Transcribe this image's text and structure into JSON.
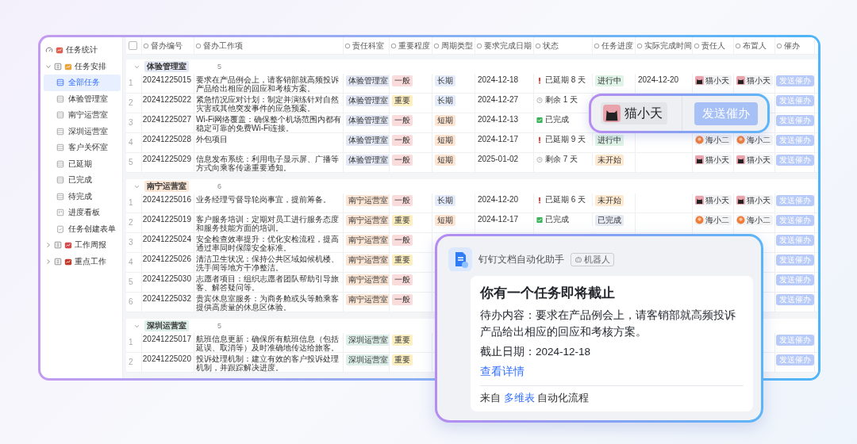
{
  "sidebar": {
    "items": [
      {
        "kind": "dashboard",
        "label": "任务统计",
        "selected": false
      },
      {
        "kind": "folder",
        "label": "任务安排",
        "selected": false,
        "expanded": true,
        "children": [
          {
            "kind": "table",
            "label": "全部任务",
            "selected": true
          },
          {
            "kind": "table",
            "label": "体验管理室",
            "selected": false
          },
          {
            "kind": "table",
            "label": "南宁运营室",
            "selected": false
          },
          {
            "kind": "table",
            "label": "深圳运营室",
            "selected": false
          },
          {
            "kind": "table",
            "label": "客户关怀室",
            "selected": false
          },
          {
            "kind": "table",
            "label": "已延期",
            "selected": false
          },
          {
            "kind": "table",
            "label": "已完成",
            "selected": false
          },
          {
            "kind": "table",
            "label": "待完成",
            "selected": false
          },
          {
            "kind": "kanban",
            "label": "进度看板",
            "selected": false
          },
          {
            "kind": "form",
            "label": "任务创建表单",
            "selected": false
          }
        ]
      },
      {
        "kind": "folder",
        "label": "工作周报",
        "selected": false,
        "expanded": false
      },
      {
        "kind": "folder",
        "label": "重点工作",
        "selected": false,
        "expanded": false
      }
    ]
  },
  "table": {
    "select_all_checked": false,
    "columns": [
      "督办编号",
      "督办工作项",
      "责任科室",
      "重要程度",
      "周期类型",
      "要求完成日期",
      "状态",
      "任务进度",
      "实际完成时间",
      "责任人",
      "布置人",
      "催办"
    ],
    "groups": [
      {
        "name": "体验管理室",
        "count": "5",
        "color": "#e3e8f4",
        "rows": [
          {
            "no": "1",
            "id": "20241225015",
            "item": "要求在产品例会上，请客销部就高频投诉产品给出相应的回应和考核方案。",
            "dept": {
              "text": "体验管理室",
              "color": "#e3e8f4"
            },
            "priority": {
              "text": "一般",
              "color": "#fbdcdc"
            },
            "cycle": {
              "text": "长期",
              "color": "#e4ecfb"
            },
            "due": "2024-12-18",
            "status": {
              "kind": "overdue",
              "text": "已延期 8 天"
            },
            "progress": {
              "text": "进行中",
              "color": "#dff3e6"
            },
            "actual": "2024-12-20",
            "owner": {
              "kind": "cat",
              "name": "猫小天"
            },
            "assigner": {
              "kind": "cat",
              "name": "猫小天"
            },
            "action": "发送催办"
          },
          {
            "no": "2",
            "id": "20241225022",
            "item": "紧急情况应对计划：制定并演练针对自然灾害或其他突发事件的应急预案。",
            "dept": {
              "text": "体验管理室",
              "color": "#e3e8f4"
            },
            "priority": {
              "text": "重要",
              "color": "#fcefc2"
            },
            "cycle": {
              "text": "长期",
              "color": "#e4ecfb"
            },
            "due": "2024-12-27",
            "status": {
              "kind": "remaining",
              "text": "剩余 1 天"
            },
            "action": "发送催办"
          },
          {
            "no": "3",
            "id": "20241225027",
            "item": "Wi-Fi网络覆盖：确保整个机场范围内都有稳定可靠的免费Wi-Fi连接。",
            "dept": {
              "text": "体验管理室",
              "color": "#e3e8f4"
            },
            "priority": {
              "text": "一般",
              "color": "#fbdcdc"
            },
            "cycle": {
              "text": "短期",
              "color": "#fde5d2"
            },
            "due": "2024-12-13",
            "status": {
              "kind": "done",
              "text": "已完成"
            },
            "action": "发送催办"
          },
          {
            "no": "4",
            "id": "20241225028",
            "item": "外包项目",
            "dept": {
              "text": "体验管理室",
              "color": "#e3e8f4"
            },
            "priority": {
              "text": "一般",
              "color": "#fbdcdc"
            },
            "cycle": {
              "text": "短期",
              "color": "#fde5d2"
            },
            "due": "2024-12-17",
            "status": {
              "kind": "overdue",
              "text": "已延期 9 天"
            },
            "progress": {
              "text": "进行中",
              "color": "#dff3e6"
            },
            "owner": {
              "kind": "round",
              "name": "海小二"
            },
            "assigner": {
              "kind": "round",
              "name": "海小二"
            },
            "action": "发送催办"
          },
          {
            "no": "5",
            "id": "20241225029",
            "item": "信息发布系统：利用电子显示屏、广播等方式向乘客传递重要通知。",
            "dept": {
              "text": "体验管理室",
              "color": "#e3e8f4"
            },
            "priority": {
              "text": "一般",
              "color": "#fbdcdc"
            },
            "cycle": {
              "text": "短期",
              "color": "#fde5d2"
            },
            "due": "2025-01-02",
            "status": {
              "kind": "remaining",
              "text": "剩余 7 天"
            },
            "progress": {
              "text": "未开始",
              "color": "#fde9cf"
            },
            "owner": {
              "kind": "cat",
              "name": "猫小天"
            },
            "assigner": {
              "kind": "cat",
              "name": "猫小天"
            },
            "action": "发送催办"
          }
        ]
      },
      {
        "name": "南宁运营室",
        "count": "6",
        "color": "#fbe6d6",
        "rows": [
          {
            "no": "1",
            "id": "20241225016",
            "item": "业务经理亏督导轮岗事宜，提前筹备。",
            "dept": {
              "text": "南宁运营室",
              "color": "#fbe6d6"
            },
            "priority": {
              "text": "一般",
              "color": "#fbdcdc"
            },
            "cycle": {
              "text": "长期",
              "color": "#e4ecfb"
            },
            "due": "2024-12-20",
            "status": {
              "kind": "overdue",
              "text": "已延期 6 天"
            },
            "progress": {
              "text": "未开始",
              "color": "#fde9cf"
            },
            "owner": {
              "kind": "cat",
              "name": "猫小天"
            },
            "assigner": {
              "kind": "cat",
              "name": "猫小天"
            },
            "action": "发送催办"
          },
          {
            "no": "2",
            "id": "20241225019",
            "item": "客户服务培训：定期对员工进行服务态度和服务技能方面的培训。",
            "dept": {
              "text": "南宁运营室",
              "color": "#fbe6d6"
            },
            "priority": {
              "text": "重要",
              "color": "#fcefc2"
            },
            "cycle": {
              "text": "短期",
              "color": "#fde5d2"
            },
            "due": "2024-12-17",
            "status": {
              "kind": "done",
              "text": "已完成"
            },
            "progress": {
              "text": "已完成",
              "color": "#e6eaf3"
            },
            "owner": {
              "kind": "round",
              "name": "海小二"
            },
            "assigner": {
              "kind": "round",
              "name": "海小二"
            },
            "action": "发送催办"
          },
          {
            "no": "3",
            "id": "20241225024",
            "item": "安全检查效率提升：优化安检流程，提高通过率同时保障安全标准。",
            "dept": {
              "text": "南宁运营室",
              "color": "#fbe6d6"
            },
            "priority": {
              "text": "一般",
              "color": "#fbdcdc"
            },
            "action": "发送催办"
          },
          {
            "no": "4",
            "id": "20241225026",
            "item": "清洁卫生状况：保持公共区域如候机楼、洗手间等地方干净整洁。",
            "dept": {
              "text": "南宁运营室",
              "color": "#fbe6d6"
            },
            "priority": {
              "text": "重要",
              "color": "#fcefc2"
            },
            "action": "发送催办"
          },
          {
            "no": "5",
            "id": "20241225030",
            "item": "志愿者项目：组织志愿者团队帮助引导旅客、解答疑问等。",
            "dept": {
              "text": "南宁运营室",
              "color": "#fbe6d6"
            },
            "priority": {
              "text": "一般",
              "color": "#fbdcdc"
            },
            "action": "发送催办"
          },
          {
            "no": "6",
            "id": "20241225032",
            "item": "贵宾休息室服务：为商务舱或头等舱乘客提供高质量的休息区体验。",
            "dept": {
              "text": "南宁运营室",
              "color": "#fbe6d6"
            },
            "priority": {
              "text": "一般",
              "color": "#fbdcdc"
            },
            "action": "发送催办"
          }
        ]
      },
      {
        "name": "深圳运营室",
        "count": "5",
        "color": "#dff0ea",
        "rows": [
          {
            "no": "1",
            "id": "20241225017",
            "item": "航班信息更新：确保所有航班信息（包括延误、取消等）及时准确地传达给旅客。",
            "dept": {
              "text": "深圳运营室",
              "color": "#dff0ea"
            },
            "priority": {
              "text": "重要",
              "color": "#fcefc2"
            },
            "action": "发送催办"
          },
          {
            "no": "2",
            "id": "20241225020",
            "item": "投诉处理机制：建立有效的客户投诉处理机制，并跟踪解决进度。",
            "dept": {
              "text": "深圳运营室",
              "color": "#dff0ea"
            },
            "priority": {
              "text": "重要",
              "color": "#fcefc2"
            },
            "action": "发送催办"
          }
        ]
      }
    ]
  },
  "callout": {
    "person": {
      "kind": "cat",
      "name": "猫小天"
    },
    "button": "发送催办"
  },
  "notification": {
    "sender": "钉钉文档自动化助手",
    "tag": "机器人",
    "title": "你有一个任务即将截止",
    "body": "待办内容：要求在产品例会上，请客销部就高频投诉产品给出相应的回应和考核方案。",
    "due": "截止日期：2024-12-18",
    "link": "查看详情",
    "footer": {
      "prefix": "来自",
      "link": "多维表",
      "suffix": "自动化流程"
    }
  }
}
